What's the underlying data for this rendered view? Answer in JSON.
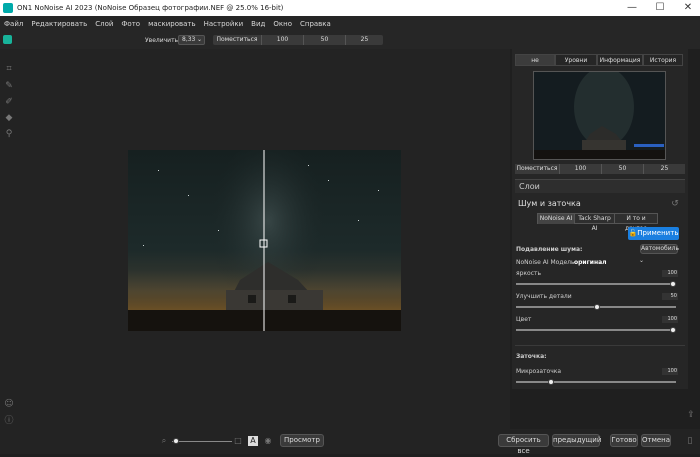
{
  "window": {
    "title": "ON1 NoNoise AI 2023 (NoNoise Образец фотографии.NEF @ 25.0% 16-bit)",
    "controls": {
      "minimize": "—",
      "maximize": "☐",
      "close": "✕"
    }
  },
  "menu": [
    "Файл",
    "Редактировать",
    "Слой",
    "Фото",
    "маскировать",
    "Настройки",
    "Вид",
    "Окно",
    "Справка"
  ],
  "toolbar": {
    "zoom_label": "Увеличить",
    "zoom_value": "8,33",
    "zoom_presets": [
      "Поместиться",
      "100",
      "50",
      "25"
    ]
  },
  "right_panel": {
    "tabs": [
      "не",
      "Уровни",
      "Информация",
      "История"
    ],
    "nav_presets": [
      "Поместиться",
      "100",
      "50",
      "25"
    ],
    "layers_title": "Слои",
    "section_title": "Шум и заточка",
    "ai_tabs": [
      "NoNoise AI",
      "Tack Sharp AI",
      "И то и другое"
    ],
    "apply_button": "Применить",
    "noise_header": "Подавление шума:",
    "auto_button": "Автомобиль",
    "model_label": "NoNoise AI Модель",
    "model_value": "оригинал",
    "sliders": [
      {
        "label": "яркость",
        "value": "100",
        "level": 1.0
      },
      {
        "label": "Улучшить детали",
        "value": "50",
        "level": 0.5
      },
      {
        "label": "Цвет",
        "value": "100",
        "level": 1.0
      }
    ],
    "sharpen_header": "Заточка:",
    "sharpen_sliders": [
      {
        "label": "Микрозаточка",
        "value": "100",
        "level": 0.25
      }
    ]
  },
  "bottom": {
    "preview_button": "Просмотр",
    "reset_all": "Сбросить все",
    "previous": "предыдущий",
    "done": "Готово",
    "cancel": "Отмена"
  },
  "colors": {
    "accent": "#1a7fe0",
    "panel": "#262626",
    "bg": "#1f1f1f"
  }
}
